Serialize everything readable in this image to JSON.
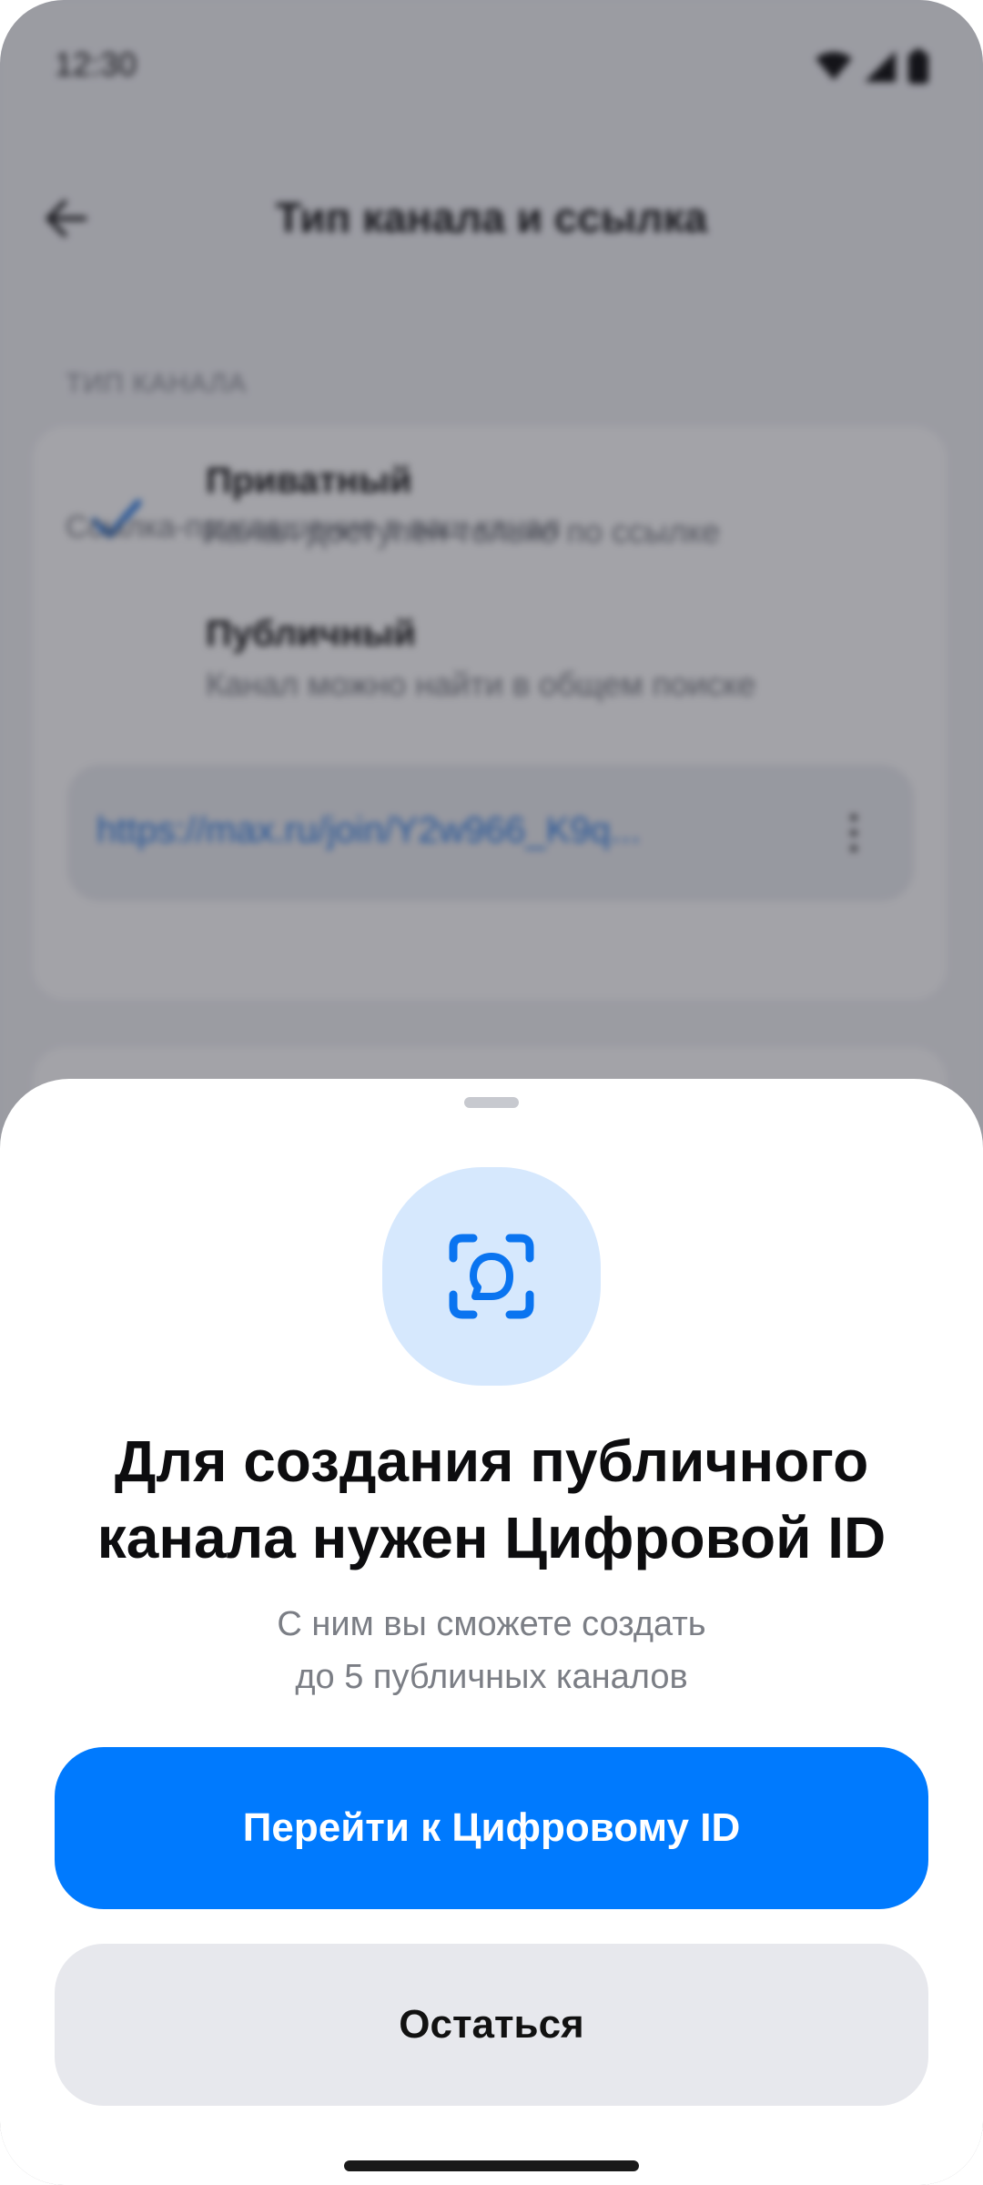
{
  "status_bar": {
    "time": "12:30",
    "icons": [
      "wifi-icon",
      "signal-icon",
      "battery-icon"
    ]
  },
  "screen": {
    "title": "Тип канала и ссылка",
    "back_icon": "arrow-left-icon",
    "section_label": "ТИП КАНАЛА",
    "options": [
      {
        "title": "Приватный",
        "subtitle": "Канал доступен только по ссылке",
        "selected": true
      },
      {
        "title": "Публичный",
        "subtitle": "Канал можно найти в общем поиске",
        "selected": false
      }
    ],
    "invite_link": "https://max.ru/join/Y2w966_K9q...",
    "invite_caption": "Ссылка-приглашение в ваш канал"
  },
  "sheet": {
    "icon": "face-scan-icon",
    "title_line1": "Для создания публичного",
    "title_line2": "канала нужен Цифровой ID",
    "subtitle_line1": "С ним вы сможете создать",
    "subtitle_line2": "до 5 публичных каналов",
    "primary_button": "Перейти к Цифровому ID",
    "secondary_button": "Остаться"
  },
  "colors": {
    "accent": "#007afe",
    "icon_bg": "#d6e8fd",
    "secondary_button_bg": "#e7e8ed",
    "link": "#2a7be4"
  }
}
